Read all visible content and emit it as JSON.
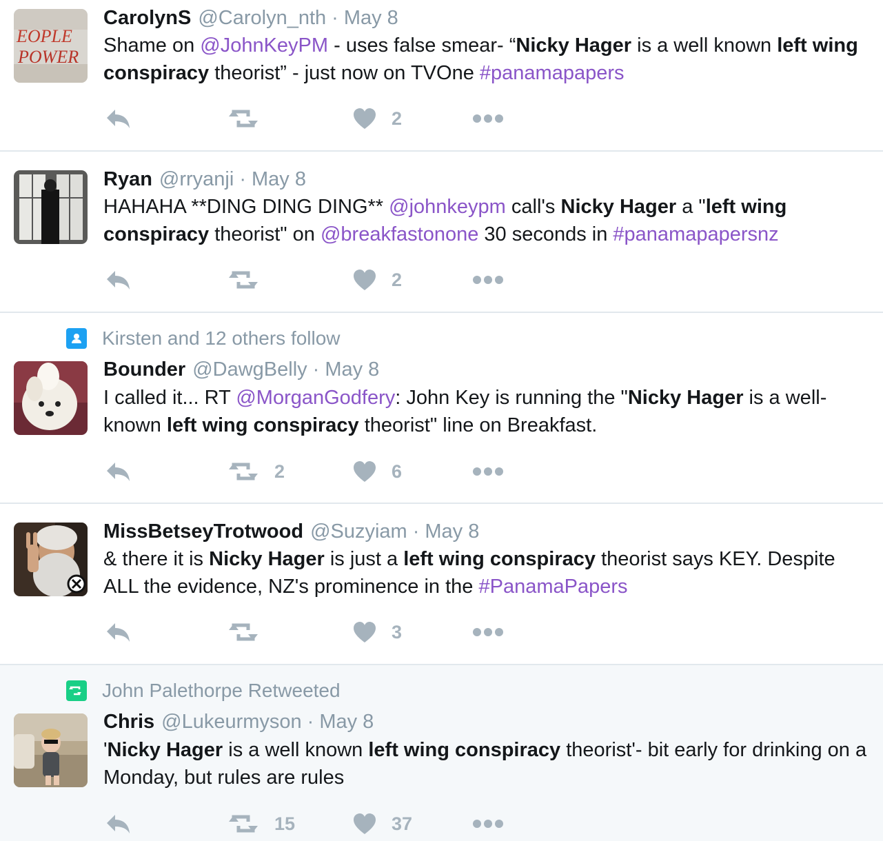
{
  "colors": {
    "link": "#8a55c8",
    "muted": "#8899a6",
    "action": "#a6b3bd",
    "follow_badge": "#1da1f2",
    "retweet_badge": "#19cf86",
    "highlight_bg": "#f5f8fa"
  },
  "tweets": [
    {
      "name": "CarolynS",
      "handle": "@Carolyn_nth",
      "sep": "·",
      "date": "May 8",
      "avatar_icon": "graffiti-avatar",
      "segments": [
        {
          "t": "Shame on "
        },
        {
          "t": "@JohnKeyPM",
          "s": "link"
        },
        {
          "t": " - uses false smear- “"
        },
        {
          "t": "Nicky Hager",
          "s": "b"
        },
        {
          "t": " is a well known "
        },
        {
          "t": "left wing conspiracy",
          "s": "b"
        },
        {
          "t": " theorist” - just now on TVOne "
        },
        {
          "t": "#panamapapers",
          "s": "link"
        }
      ],
      "retweets": "",
      "likes": "2"
    },
    {
      "name": "Ryan",
      "handle": "@rryanji",
      "sep": "·",
      "date": "May 8",
      "avatar_icon": "man-at-window-avatar",
      "segments": [
        {
          "t": "HAHAHA **DING DING DING** "
        },
        {
          "t": "@johnkeypm",
          "s": "link"
        },
        {
          "t": " call's "
        },
        {
          "t": "Nicky Hager",
          "s": "b"
        },
        {
          "t": " a \""
        },
        {
          "t": "left wing conspiracy",
          "s": "b"
        },
        {
          "t": " theorist\" on "
        },
        {
          "t": "@breakfastonone",
          "s": "link"
        },
        {
          "t": " 30 seconds in "
        },
        {
          "t": "#panamapapersnz",
          "s": "link"
        }
      ],
      "retweets": "",
      "likes": "2"
    },
    {
      "context": "Kirsten and 12 others follow",
      "context_icon": "person-icon",
      "name": "Bounder",
      "handle": "@DawgBelly",
      "sep": "·",
      "date": "May 8",
      "avatar_icon": "dog-avatar",
      "segments": [
        {
          "t": "I called it... RT "
        },
        {
          "t": "@MorganGodfery",
          "s": "link"
        },
        {
          "t": ": John Key is running the \""
        },
        {
          "t": "Nicky Hager",
          "s": "b"
        },
        {
          "t": " is a well-known "
        },
        {
          "t": "left wing conspiracy",
          "s": "b"
        },
        {
          "t": " theorist\" line on Breakfast."
        }
      ],
      "retweets": "2",
      "likes": "6"
    },
    {
      "name": "MissBetseyTrotwood",
      "handle": "@Suzyiam",
      "sep": "·",
      "date": "May 8",
      "avatar_icon": "bearded-man-avatar",
      "segments": [
        {
          "t": "& there it is "
        },
        {
          "t": "Nicky Hager",
          "s": "b"
        },
        {
          "t": " is just a "
        },
        {
          "t": "left wing conspiracy",
          "s": "b"
        },
        {
          "t": " theorist says KEY. Despite ALL the evidence, NZ's prominence in the "
        },
        {
          "t": "#PanamaPapers",
          "s": "link"
        }
      ],
      "retweets": "",
      "likes": "3"
    },
    {
      "context": "John Palethorpe Retweeted",
      "context_icon": "retweet-badge-icon",
      "name": "Chris",
      "handle": "@Lukeurmyson",
      "sep": "·",
      "date": "May 8",
      "avatar_icon": "child-avatar",
      "segments": [
        {
          "t": "'"
        },
        {
          "t": "Nicky Hager",
          "s": "b"
        },
        {
          "t": " is a well known "
        },
        {
          "t": "left wing conspiracy",
          "s": "b"
        },
        {
          "t": " theorist'- bit early for drinking on a Monday, but rules are rules"
        }
      ],
      "retweets": "15",
      "likes": "37"
    }
  ]
}
